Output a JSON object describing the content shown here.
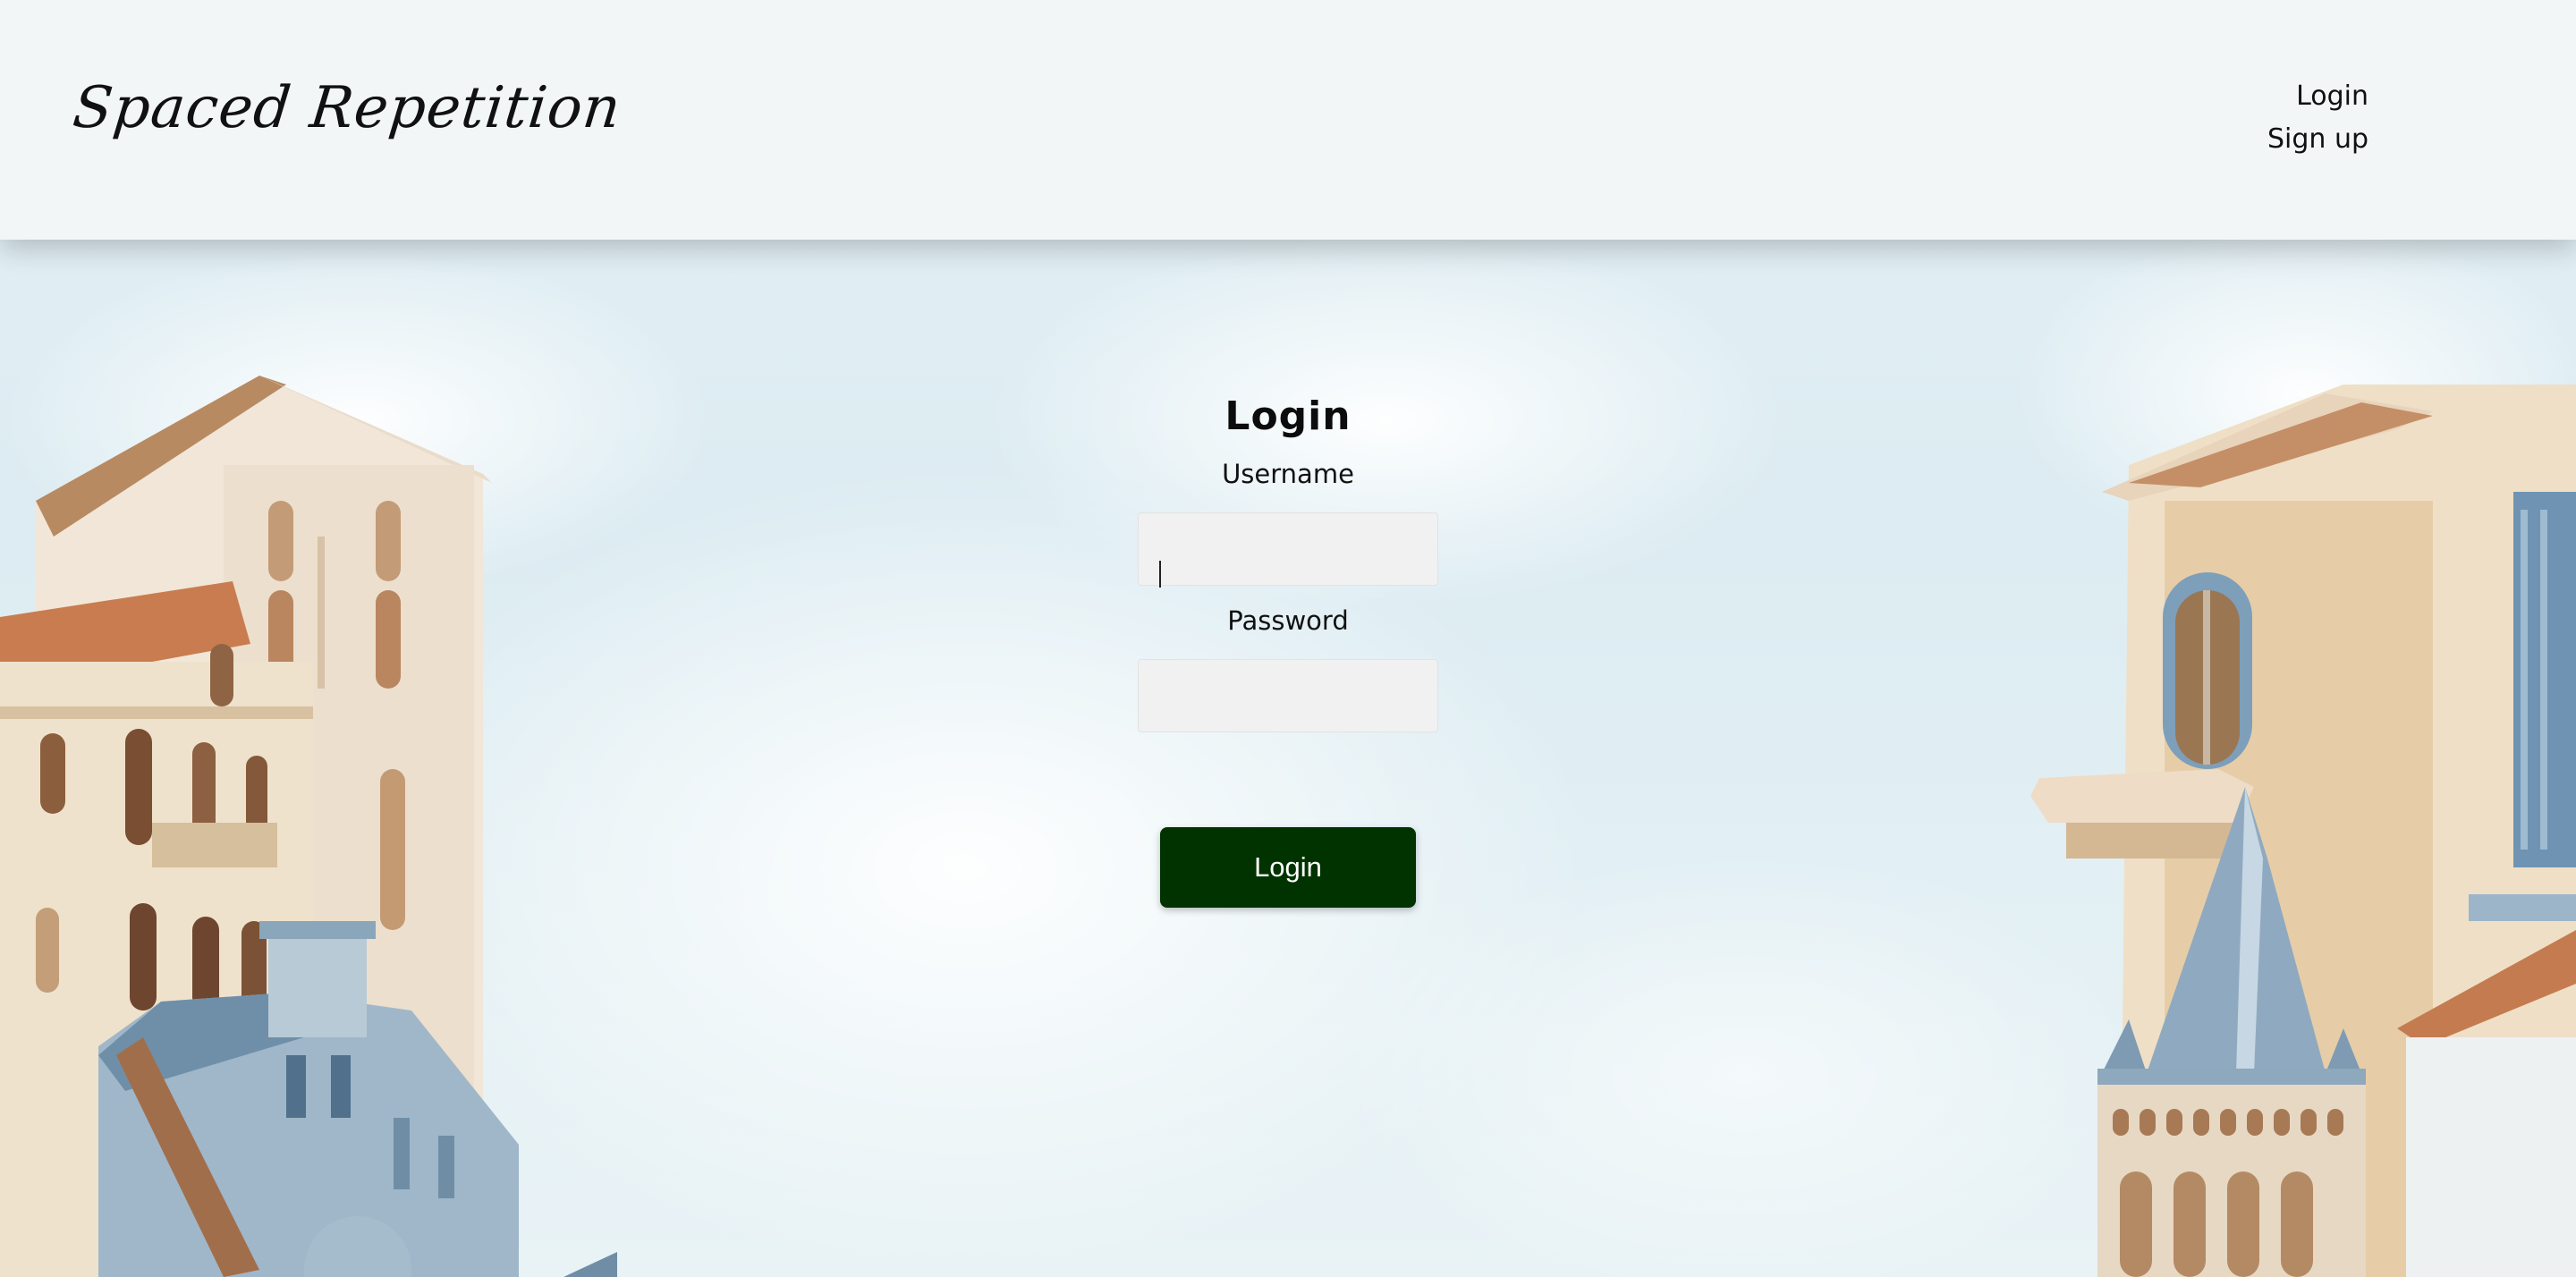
{
  "header": {
    "logo": "Spaced Repetition",
    "nav": {
      "login": "Login",
      "signup": "Sign up"
    }
  },
  "form": {
    "title": "Login",
    "username_label": "Username",
    "username_value": "",
    "password_label": "Password",
    "password_value": "",
    "submit_label": "Login"
  },
  "colors": {
    "header_bg": "#f2f6f7",
    "button_bg": "#003300",
    "sky": "#dcecf2"
  },
  "background": {
    "description_icon": "watercolor-buildings-illustration"
  }
}
